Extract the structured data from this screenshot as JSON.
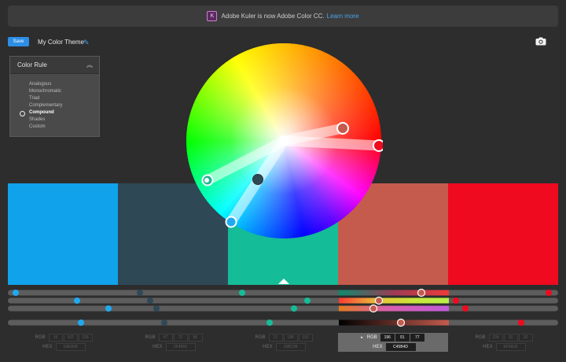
{
  "banner": {
    "text": "Adobe Kuler is now Adobe Color CC.",
    "link": "Learn more",
    "logo_glyph": "K"
  },
  "toolbar": {
    "save_label": "Save",
    "theme_name": "My Color Theme",
    "edit_icon": "pencil-icon",
    "camera_icon": "camera-icon"
  },
  "color_rule": {
    "title": "Color Rule",
    "collapse_icon": "chevron-up-icon",
    "items": [
      {
        "label": "Analogous",
        "selected": false
      },
      {
        "label": "Monochromatic",
        "selected": false
      },
      {
        "label": "Triad",
        "selected": false
      },
      {
        "label": "Complementary",
        "selected": false
      },
      {
        "label": "Compound",
        "selected": true
      },
      {
        "label": "Shades",
        "selected": false
      },
      {
        "label": "Custom",
        "selected": false
      }
    ]
  },
  "swatches": [
    {
      "color": "#10A2EB",
      "rgb": [
        "16",
        "162",
        "235"
      ],
      "hex": "10A2EB",
      "active": false
    },
    {
      "color": "#2F4856",
      "rgb": [
        "47",
        "72",
        "86"
      ],
      "hex": "2F4856",
      "active": false
    },
    {
      "color": "#15BC98",
      "rgb": [
        "21",
        "188",
        "152"
      ],
      "hex": "15BC98",
      "active": false
    },
    {
      "color": "#C45B4D",
      "rgb": [
        "196",
        "91",
        "77"
      ],
      "hex": "C45B4D",
      "active": true
    },
    {
      "color": "#EF0A20",
      "rgb": [
        "239",
        "10",
        "32"
      ],
      "hex": "EF0A20",
      "active": false
    }
  ],
  "labels": {
    "rgb": "RGB",
    "hex": "HEX"
  },
  "selected_index": 3
}
